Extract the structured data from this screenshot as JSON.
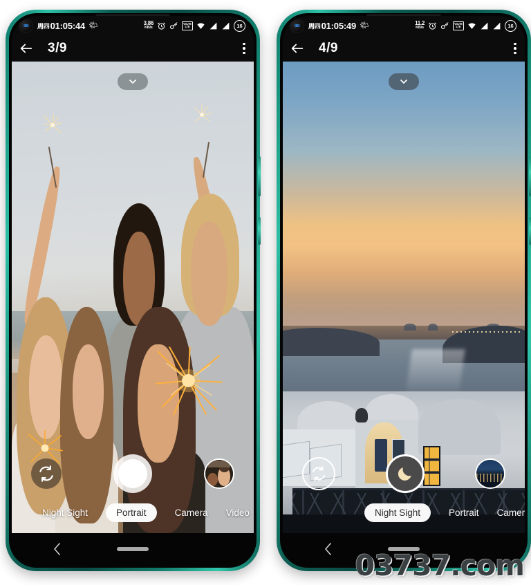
{
  "watermark": "03737.com",
  "phones": [
    {
      "id": "left",
      "status": {
        "day": "周四",
        "time": "01:05:44",
        "weather_icon": "weather-icon",
        "net_speed_value": "3.86",
        "net_speed_unit": "KB/s",
        "alarm_icon": "alarm-icon",
        "key_icon": "key-icon",
        "volte_label_top": "VoLTE",
        "volte_label_bottom": "LTE",
        "wifi_icon": "wifi-icon",
        "signal1_icon": "signal-icon",
        "signal2_icon": "signal-icon",
        "battery_level": "16"
      },
      "appbar": {
        "back_icon": "back-arrow-icon",
        "title": "3/9",
        "overflow_icon": "kebab-menu-icon"
      },
      "viewfinder": {
        "expand_icon": "chevron-down-icon",
        "flip_camera_icon": "flip-camera-icon",
        "shutter_icon": "shutter-button",
        "thumbnail_name": "last-photo-thumbnail"
      },
      "modes": [
        {
          "label": "Night Sight",
          "active": false
        },
        {
          "label": "Portrait",
          "active": true
        },
        {
          "label": "Camera",
          "active": false
        },
        {
          "label": "Video",
          "active": false
        }
      ],
      "nav": {
        "back_icon": "nav-back-icon",
        "home_icon": "nav-home-indicator"
      }
    },
    {
      "id": "right",
      "status": {
        "day": "周四",
        "time": "01:05:49",
        "weather_icon": "weather-icon",
        "net_speed_value": "11.2",
        "net_speed_unit": "KB/s",
        "alarm_icon": "alarm-icon",
        "key_icon": "key-icon",
        "volte_label_top": "VoLTE",
        "volte_label_bottom": "LTE",
        "wifi_icon": "wifi-icon",
        "signal1_icon": "signal-icon",
        "signal2_icon": "signal-icon",
        "battery_level": "16"
      },
      "appbar": {
        "back_icon": "back-arrow-icon",
        "title": "4/9",
        "overflow_icon": "kebab-menu-icon"
      },
      "viewfinder": {
        "expand_icon": "chevron-down-icon",
        "flip_camera_icon": "flip-camera-icon",
        "shutter_icon": "night-sight-moon-icon",
        "thumbnail_name": "last-photo-thumbnail"
      },
      "modes": [
        {
          "label": "Night Sight",
          "active": true
        },
        {
          "label": "Portrait",
          "active": false
        },
        {
          "label": "Camera",
          "active": false
        }
      ],
      "nav": {
        "back_icon": "nav-back-icon",
        "home_icon": "nav-home-indicator"
      }
    }
  ],
  "colors": {
    "frame_teal": "#0f7a6a",
    "frame_teal_light": "#2fc6ab",
    "statusbar_bg": "#0c0c0c",
    "mode_active_bg": "#ffffff",
    "mode_active_text": "#2c2c2c",
    "shutter_white": "#ffffff",
    "night_shutter_bg": "#4a4a4a",
    "watermark_color": "#3a3f42"
  }
}
